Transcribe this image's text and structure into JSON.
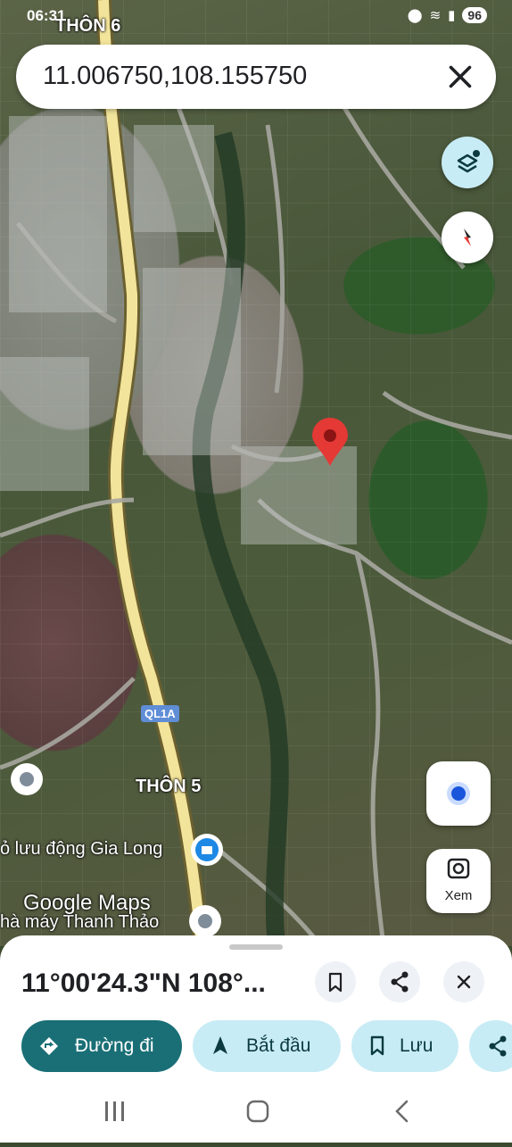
{
  "status_bar": {
    "time": "06:31",
    "battery": "96"
  },
  "search": {
    "value": "11.006750,108.155750"
  },
  "map": {
    "labels": {
      "thon6": "THÔN 6",
      "thon5": "THÔN 5",
      "road": "QL1A",
      "poi1": "ỏ lưu động Gia Long",
      "poi2": "hà máy Thanh Thảo",
      "watermark": "Google Maps"
    },
    "xem_label": "Xem"
  },
  "sheet": {
    "coordinates": "11°00'24.3\"N 108°...",
    "chips": {
      "directions": "Đường đi",
      "start": "Bắt đầu",
      "save": "Lưu"
    }
  },
  "colors": {
    "accent": "#1a6f76",
    "chip_bg": "#c8ecf5",
    "pin": "#e53935"
  }
}
